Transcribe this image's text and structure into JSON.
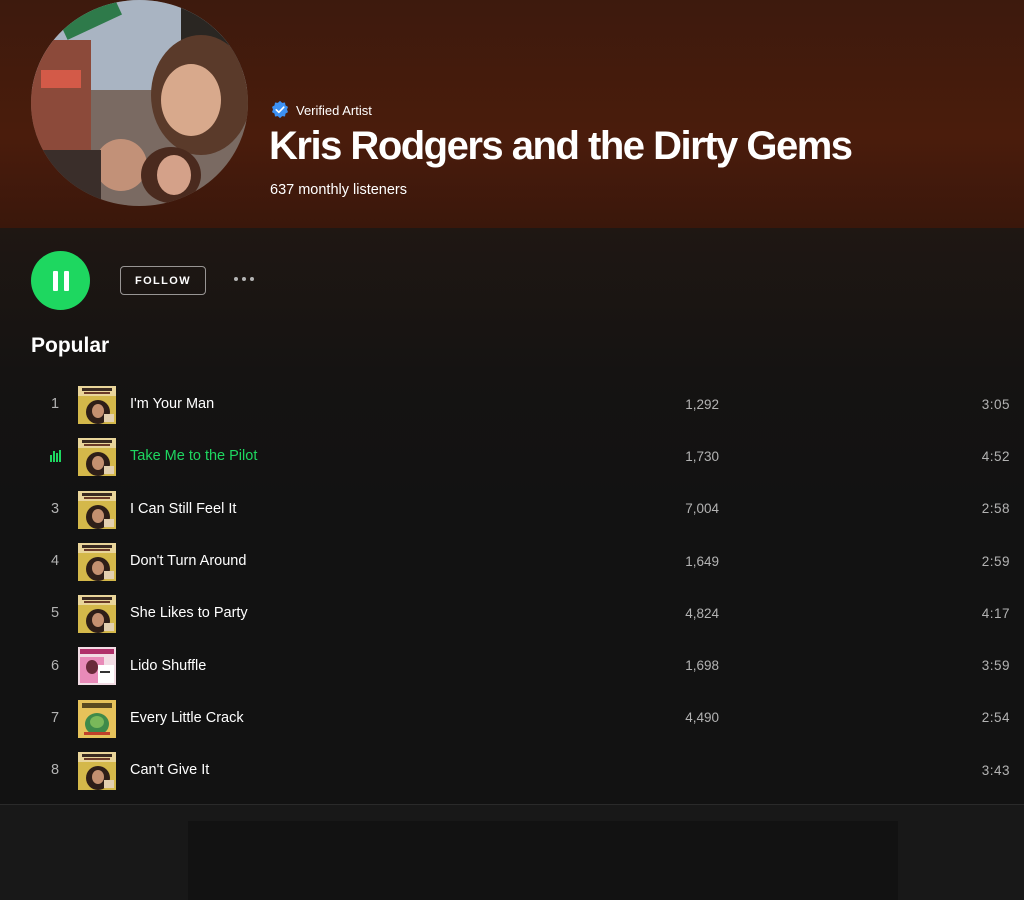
{
  "artist": {
    "verified_label": "Verified Artist",
    "name": "Kris Rodgers and the Dirty Gems",
    "monthly_listeners": "637 monthly listeners"
  },
  "actions": {
    "play_state": "pause",
    "follow_label": "FOLLOW",
    "more_icon": "more-horizontal-icon"
  },
  "popular": {
    "heading": "Popular",
    "tracks": [
      {
        "num": "1",
        "title": "I'm Your Man",
        "plays": "1,292",
        "duration": "3:05",
        "art": "dirty-gems-cover"
      },
      {
        "num": "2",
        "title": "Take Me to the Pilot",
        "plays": "1,730",
        "duration": "4:52",
        "art": "dirty-gems-cover",
        "playing": true
      },
      {
        "num": "3",
        "title": "I Can Still Feel It",
        "plays": "7,004",
        "duration": "2:58",
        "art": "dirty-gems-cover"
      },
      {
        "num": "4",
        "title": "Don't Turn Around",
        "plays": "1,649",
        "duration": "2:59",
        "art": "dirty-gems-cover"
      },
      {
        "num": "5",
        "title": "She Likes to Party",
        "plays": "4,824",
        "duration": "4:17",
        "art": "dirty-gems-cover"
      },
      {
        "num": "6",
        "title": "Lido Shuffle",
        "plays": "1,698",
        "duration": "3:59",
        "art": "kris-rodgers-cover"
      },
      {
        "num": "7",
        "title": "Every Little Crack",
        "plays": "4,490",
        "duration": "2:54",
        "art": "yellow-cover"
      },
      {
        "num": "8",
        "title": "Can't Give It",
        "plays": "",
        "duration": "3:43",
        "art": "dirty-gems-cover"
      }
    ]
  },
  "colors": {
    "accent": "#1ed760",
    "header_bg": "#4a1c0c",
    "page_bg": "#121212",
    "muted_text": "#b3b3b3"
  }
}
